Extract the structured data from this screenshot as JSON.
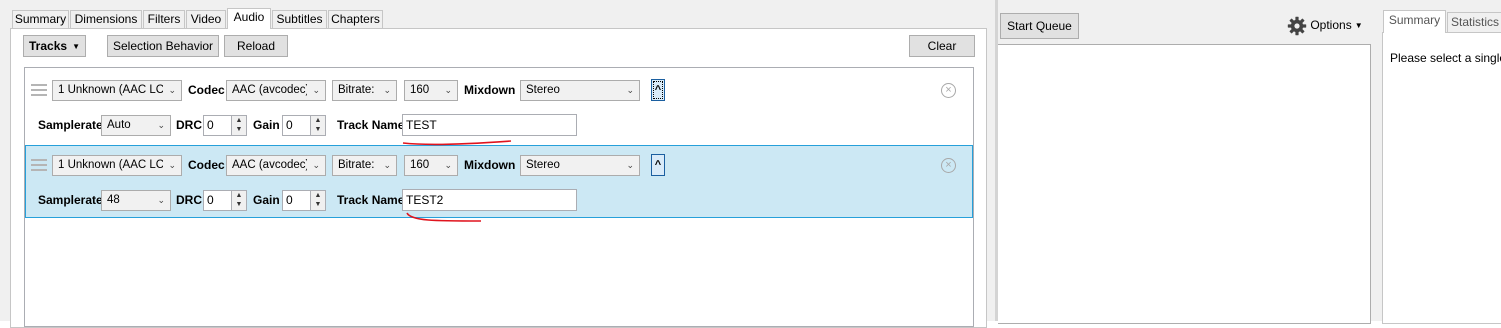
{
  "tabs": [
    "Summary",
    "Dimensions",
    "Filters",
    "Video",
    "Audio",
    "Subtitles",
    "Chapters"
  ],
  "toolbar": {
    "tracks_label": "Tracks",
    "selection_behavior_label": "Selection Behavior",
    "reload_label": "Reload",
    "clear_label": "Clear"
  },
  "labels": {
    "codec": "Codec",
    "mixdown": "Mixdown",
    "samplerate": "Samplerate",
    "drc": "DRC",
    "gain": "Gain",
    "track_name": "Track Name"
  },
  "tracks": [
    {
      "source": "1 Unknown (AAC LC",
      "codec": "AAC (avcodec)",
      "bitrate_mode": "Bitrate:",
      "bitrate": "160",
      "mixdown": "Stereo",
      "expand_glyph": "^",
      "samplerate": "Auto",
      "drc": "0",
      "gain": "0",
      "track_name": "TEST",
      "selected": false
    },
    {
      "source": "1 Unknown (AAC LC",
      "codec": "AAC (avcodec)",
      "bitrate_mode": "Bitrate:",
      "bitrate": "160",
      "mixdown": "Stereo",
      "expand_glyph": "^",
      "samplerate": "48",
      "drc": "0",
      "gain": "0",
      "track_name": "TEST2",
      "selected": true
    }
  ],
  "queue": {
    "start_queue_label": "Start Queue",
    "options_label": "Options"
  },
  "right_panel": {
    "tabs": [
      "Summary",
      "Statistics"
    ],
    "message": "Please select a single"
  },
  "icons": {
    "gear": "gear-icon",
    "dropdown": "chevron-down-icon",
    "remove": "close-circle-icon",
    "drag": "drag-handle-icon"
  },
  "colors": {
    "selected_row_bg": "#cce8f4",
    "selected_row_border": "#26a0da",
    "annotation_red": "#e0141e"
  }
}
